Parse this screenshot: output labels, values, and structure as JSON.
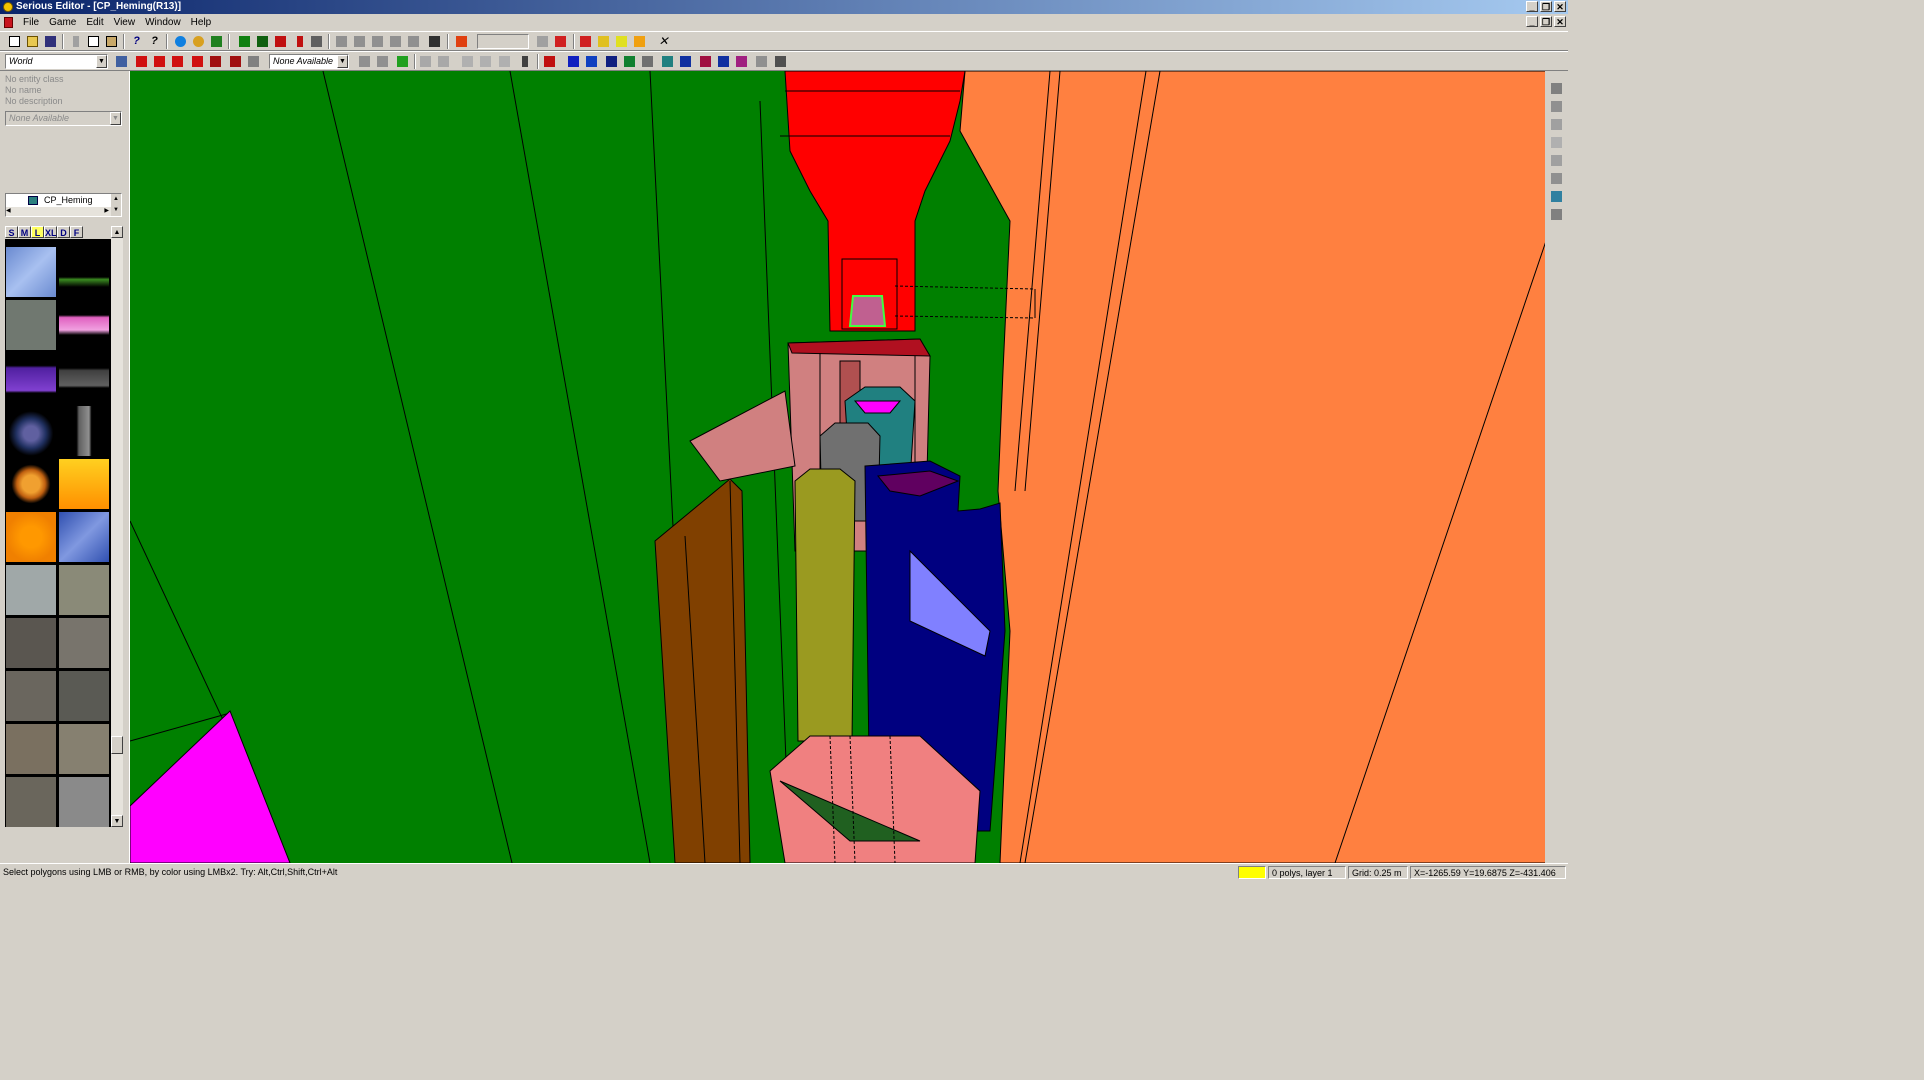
{
  "window": {
    "title": "Serious Editor - [CP_Heming(R13)]",
    "caption_buttons": [
      "_",
      "❐",
      "✕"
    ]
  },
  "menu": {
    "items": [
      "File",
      "Game",
      "Edit",
      "View",
      "Window",
      "Help"
    ]
  },
  "toolbar": {
    "world_combo": "World",
    "none_combo": "None Available"
  },
  "entity_info": {
    "class": "No entity class",
    "name": "No name",
    "description": "No description",
    "combo": "None Available"
  },
  "tree": {
    "root_label": "CP_Heming"
  },
  "texture_browser": {
    "size_tabs": [
      "S",
      "M",
      "L",
      "XL",
      "D",
      "F"
    ],
    "active_tab": "L"
  },
  "status": {
    "hint": "Select polygons using LMB or RMB, by color using LMBx2. Try: Alt,Ctrl,Shift,Ctrl+Alt",
    "polys": "0 polys, layer 1",
    "grid": "Grid: 0.25 m",
    "coords": "X=-1265.59 Y=19.6875 Z=-431.406",
    "selection_color": "#ffff00"
  },
  "colors": {
    "viewport_green": "#008000",
    "orange": "#ff8040",
    "red": "#ff0000",
    "magenta": "#ff00ff",
    "navy": "#000080",
    "pink": "#f08080"
  }
}
